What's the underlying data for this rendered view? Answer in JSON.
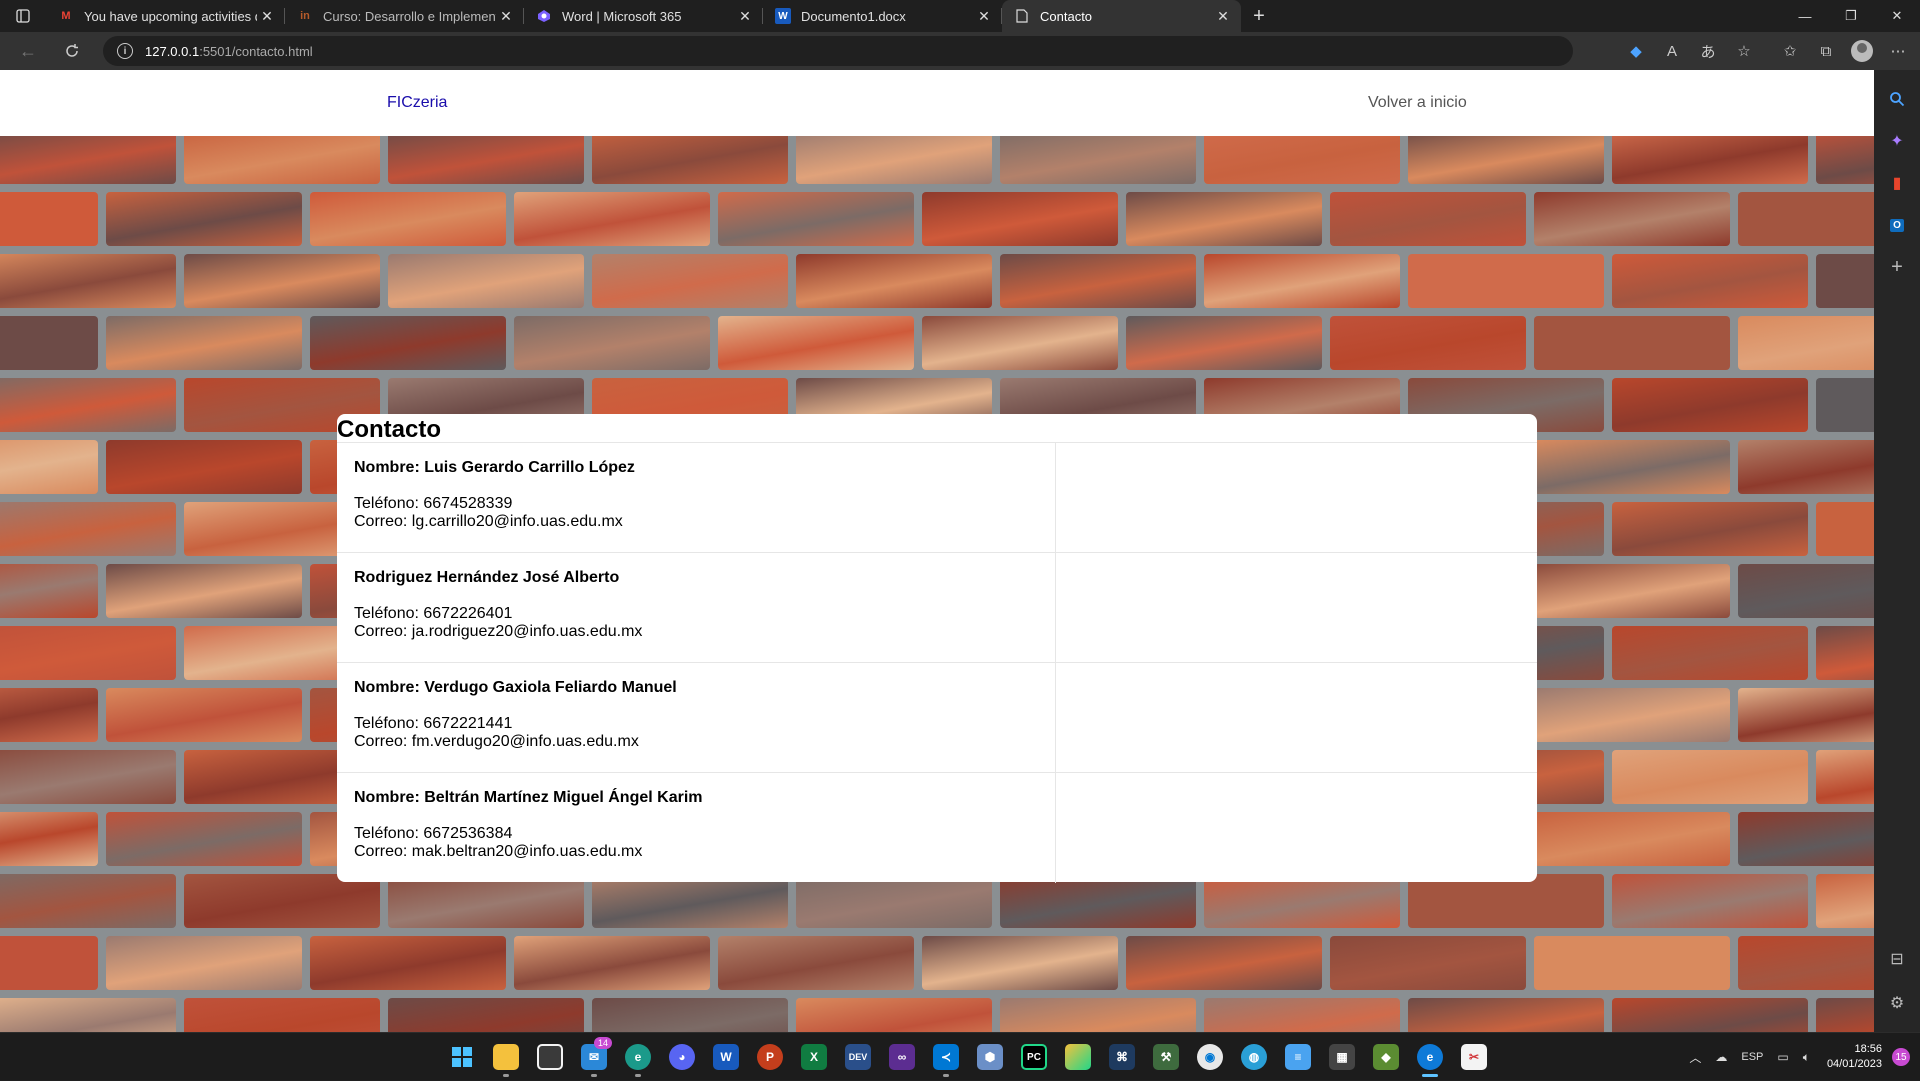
{
  "browser": {
    "tabs": [
      {
        "title": "You have upcoming activities du",
        "icon": "gmail-icon",
        "active": false
      },
      {
        "title": "Curso: Desarrollo e Implementac",
        "icon": "course-icon",
        "active": false
      },
      {
        "title": "Word | Microsoft 365",
        "icon": "microsoft365-icon",
        "active": false
      },
      {
        "title": "Documento1.docx",
        "icon": "word-icon",
        "active": false
      },
      {
        "title": "Contacto",
        "icon": "page-icon",
        "active": true
      }
    ],
    "url_host": "127.0.0.1",
    "url_rest": ":5501/contacto.html"
  },
  "site": {
    "brand": "FICzeria",
    "home_link": "Volver a inicio"
  },
  "contact": {
    "title": "Contacto",
    "entries": [
      {
        "name": "Nombre: Luis Gerardo Carrillo López",
        "phone": "Teléfono: 6674528339",
        "email": "Correo: lg.carrillo20@info.uas.edu.mx"
      },
      {
        "name": "Rodriguez Hernández José Alberto",
        "phone": "Teléfono: 6672226401",
        "email": "Correo: ja.rodriguez20@info.uas.edu.mx"
      },
      {
        "name": "Nombre: Verdugo Gaxiola Feliardo Manuel",
        "phone": "Teléfono: 6672221441",
        "email": "Correo: fm.verdugo20@info.uas.edu.mx"
      },
      {
        "name": "Nombre: Beltrán Martínez Miguel Ángel Karim",
        "phone": "Teléfono: 6672536384",
        "email": "Correo: mak.beltran20@info.uas.edu.mx"
      }
    ]
  },
  "taskbar": {
    "mail_badge": "14",
    "language": "ESP",
    "time": "18:56",
    "date": "04/01/2023",
    "notifications": "15"
  },
  "colors": {
    "brand_link": "#1a0dab",
    "taskbar_accent": "#5ec3ff",
    "badge": "#c84ad2"
  }
}
